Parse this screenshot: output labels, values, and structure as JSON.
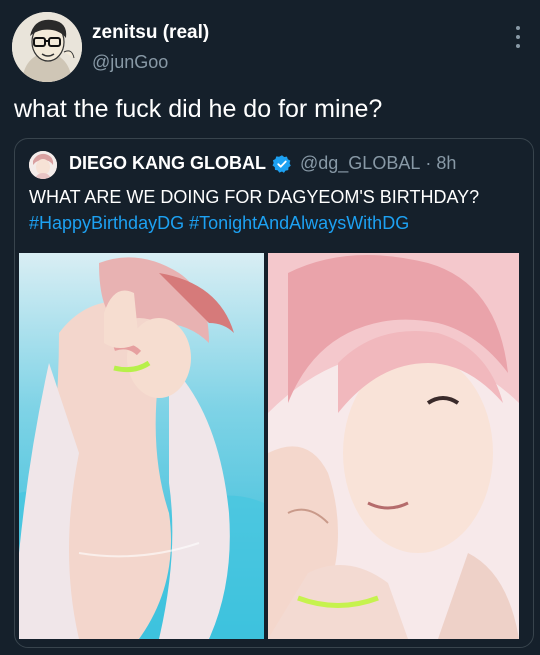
{
  "tweet": {
    "display_name": "zenitsu (real)",
    "handle": "@junGoo",
    "text": "what the fuck did he do for mine?",
    "more_icon": "more-vertical-icon"
  },
  "quoted": {
    "display_name": "DIEGO KANG GLOBAL",
    "verified_icon": "verified-badge-icon",
    "handle": "@dg_GLOBAL",
    "separator": "·",
    "time": "8h",
    "text": "WHAT ARE WE DOING FOR DAGYEOM'S BIRTHDAY?",
    "hashtags": [
      "#HappyBirthdayDG",
      "#TonightAndAlwaysWithDG"
    ]
  },
  "colors": {
    "background": "#15202b",
    "secondary_text": "#8899a6",
    "link": "#1da1f2",
    "border": "#38444d",
    "verified": "#1da1f2"
  }
}
